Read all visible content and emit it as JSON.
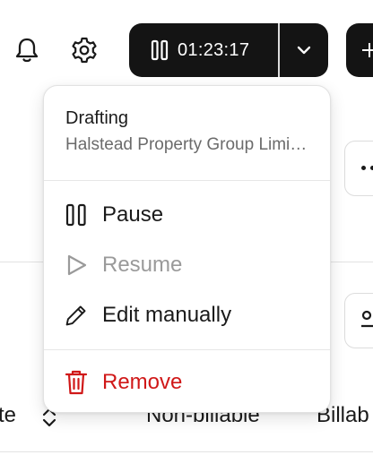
{
  "header": {
    "icons": [
      "bell-icon",
      "gear-icon"
    ],
    "timer": {
      "elapsed": "01:23:17",
      "icon": "pause-icon"
    },
    "dropdown_icon": "chevron-down-icon",
    "add_icon": "plus-icon"
  },
  "menu": {
    "title": "Drafting",
    "subtitle": "Halstead Property Group Limited",
    "items": [
      {
        "label": "Pause",
        "icon": "pause-icon",
        "state": "enabled"
      },
      {
        "label": "Resume",
        "icon": "play-icon",
        "state": "disabled"
      },
      {
        "label": "Edit manually",
        "icon": "pencil-icon",
        "state": "enabled"
      }
    ],
    "danger_item": {
      "label": "Remove",
      "icon": "trash-icon",
      "color": "#d01818"
    }
  },
  "table": {
    "columns": [
      "te",
      "Non-billable",
      "Billab"
    ]
  },
  "colors": {
    "timer_bg": "#141414",
    "danger": "#d01818",
    "muted": "#6b6b6b",
    "disabled": "#9a9a9a"
  }
}
